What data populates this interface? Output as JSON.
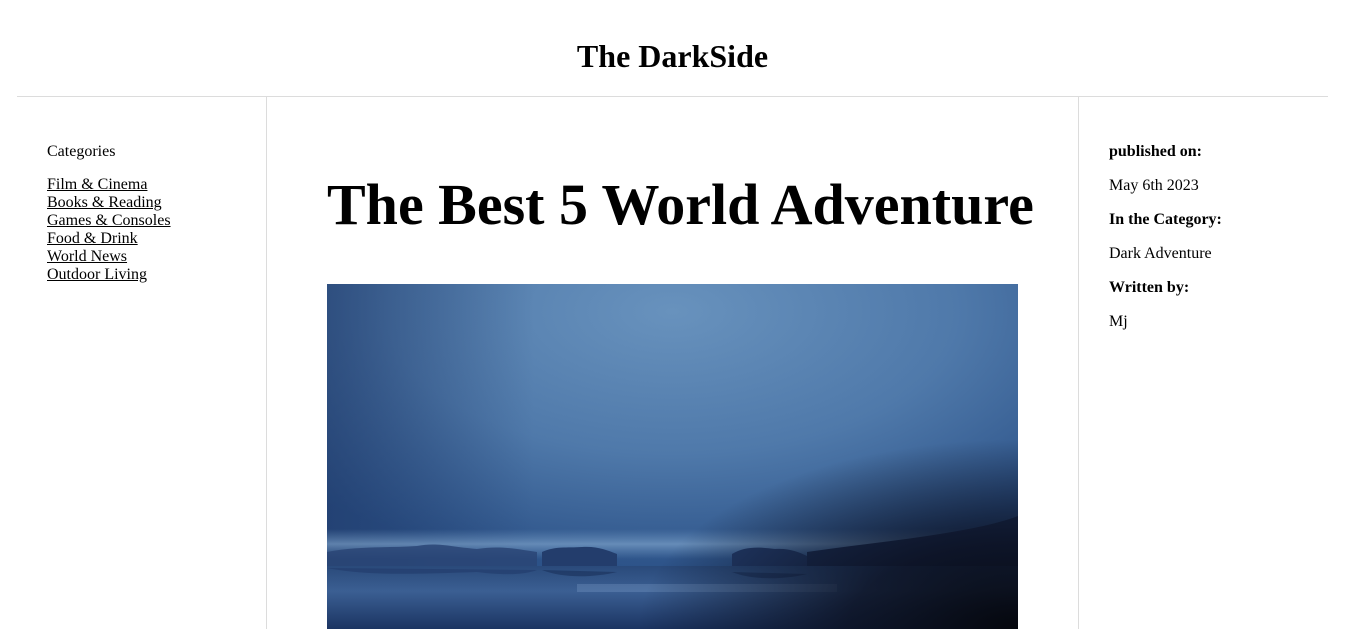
{
  "header": {
    "site_title": "The DarkSide"
  },
  "sidebar": {
    "heading": "Categories",
    "categories": [
      {
        "label": "Film & Cinema"
      },
      {
        "label": "Books & Reading"
      },
      {
        "label": "Games & Consoles"
      },
      {
        "label": "Food & Drink"
      },
      {
        "label": "World News"
      },
      {
        "label": "Outdoor Living"
      }
    ]
  },
  "article": {
    "title": "The Best 5 World Adventure",
    "image": {
      "icon": "misty-lake-landscape-image",
      "colors": {
        "sky_top": "#5f8bb8",
        "sky_edge": "#2f568d",
        "water": "#1e3a68",
        "shadow": "#0b0f1c"
      }
    }
  },
  "meta": {
    "published_label": "published on:",
    "published_value": "May 6th 2023",
    "category_label": "In the Category:",
    "category_value": "Dark Adventure",
    "author_label": "Written by:",
    "author_value": "Mj"
  },
  "colors": {
    "divider": "#dcdcdc",
    "text": "#000000",
    "background": "#ffffff"
  }
}
